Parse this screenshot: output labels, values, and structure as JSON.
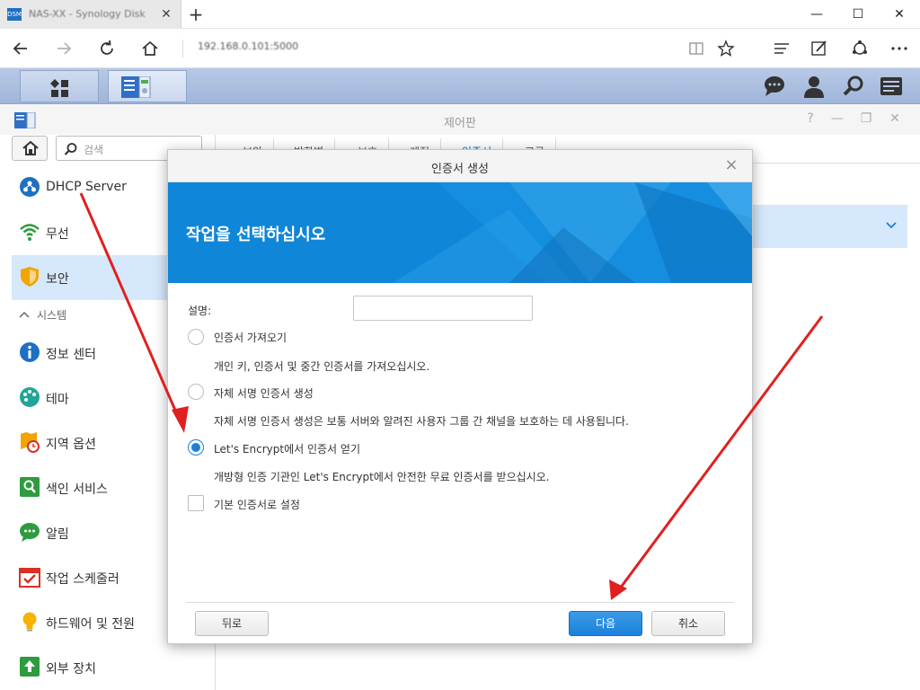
{
  "browser": {
    "tab_title": "NAS-XX - Synology DiskStation",
    "tab_icon_text": "DSM",
    "address": "192.168.0.101:5000",
    "new_tab": "+",
    "window_controls": {
      "minimize": "—",
      "maximize": "☐",
      "close": "✕"
    }
  },
  "taskbar": {
    "buttons": [
      "main-menu",
      "control-panel"
    ],
    "right_icons": [
      "chat-icon",
      "user-icon",
      "search-icon",
      "widgets-icon"
    ]
  },
  "control_panel": {
    "title": "제어판",
    "search_placeholder": "검색",
    "sidebar": {
      "items": [
        {
          "label": "DHCP Server",
          "icon": "dhcp-icon"
        },
        {
          "label": "무선",
          "icon": "wireless-icon"
        },
        {
          "label": "보안",
          "icon": "security-icon",
          "active": true
        }
      ],
      "section": "시스템",
      "system_items": [
        {
          "label": "정보 센터",
          "icon": "info-icon"
        },
        {
          "label": "테마",
          "icon": "theme-icon"
        },
        {
          "label": "지역 옵션",
          "icon": "region-icon"
        },
        {
          "label": "색인 서비스",
          "icon": "index-icon"
        },
        {
          "label": "알림",
          "icon": "notification-icon"
        },
        {
          "label": "작업 스케줄러",
          "icon": "scheduler-icon"
        },
        {
          "label": "하드웨어 및 전원",
          "icon": "hardware-icon"
        },
        {
          "label": "외부 장치",
          "icon": "external-device-icon"
        }
      ]
    },
    "tabs": [
      "보안",
      "방화벽",
      "보호",
      "계정",
      "인증서",
      "고급"
    ],
    "active_tab": "인증서"
  },
  "dialog": {
    "title": "인증서 생성",
    "heading": "작업을 선택하십시오",
    "description_label": "설명:",
    "description_value": "",
    "options": [
      {
        "label": "인증서 가져오기",
        "description": "개인 키, 인증서 및 중간 인증서를 가져오십시오.",
        "checked": false
      },
      {
        "label": "자체 서명 인증서 생성",
        "description": "자체 서명 인증서 생성은 보통 서버와 알려진 사용자 그룹 간 채널을 보호하는 데 사용됩니다.",
        "checked": false
      },
      {
        "label": "Let's Encrypt에서 인증서 얻기",
        "description": "개방형 인증 기관인 Let's Encrypt에서 안전한 무료 인증서를 받으십시오.",
        "checked": true
      }
    ],
    "default_checkbox_label": "기본 인증서로 설정",
    "default_checked": false,
    "back_button": "뒤로",
    "next_button": "다음",
    "cancel_button": "취소"
  },
  "colors": {
    "accent": "#1a80d9",
    "banner": "#0f86d8",
    "sidebar_active": "#d6e8fb",
    "annotation_arrow": "#e02020"
  }
}
